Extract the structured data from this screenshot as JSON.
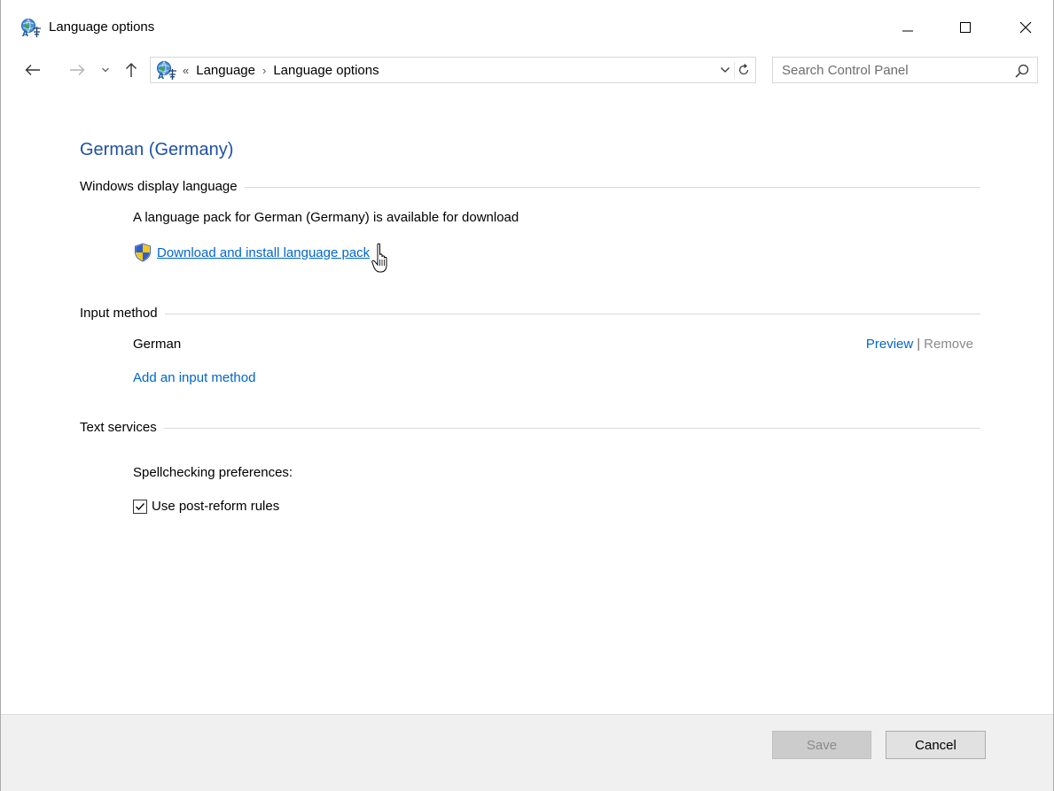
{
  "window": {
    "title": "Language options",
    "minimize_label": "Minimize",
    "maximize_label": "Maximize",
    "close_label": "Close"
  },
  "nav": {
    "overflow": "«",
    "breadcrumbs": [
      "Language",
      "Language options"
    ],
    "separator": "›"
  },
  "search": {
    "placeholder": "Search Control Panel",
    "value": ""
  },
  "content": {
    "language_title": "German (Germany)",
    "display_section": {
      "heading": "Windows display language",
      "availability_text": "A language pack for German (Germany) is available for download",
      "download_link": "Download and install language pack"
    },
    "input_section": {
      "heading": "Input method",
      "method_name": "German",
      "preview_link": "Preview",
      "divider": "|",
      "remove_link": "Remove",
      "add_link": "Add an input method"
    },
    "text_section": {
      "heading": "Text services",
      "spellcheck_label": "Spellchecking preferences:",
      "post_reform_label": "Use post-reform rules",
      "post_reform_checked": true
    }
  },
  "footer": {
    "save_label": "Save",
    "cancel_label": "Cancel"
  },
  "colors": {
    "title_blue": "#1e4fa8",
    "link_blue": "#0066cc",
    "footer_bg": "#f0f0f0"
  }
}
